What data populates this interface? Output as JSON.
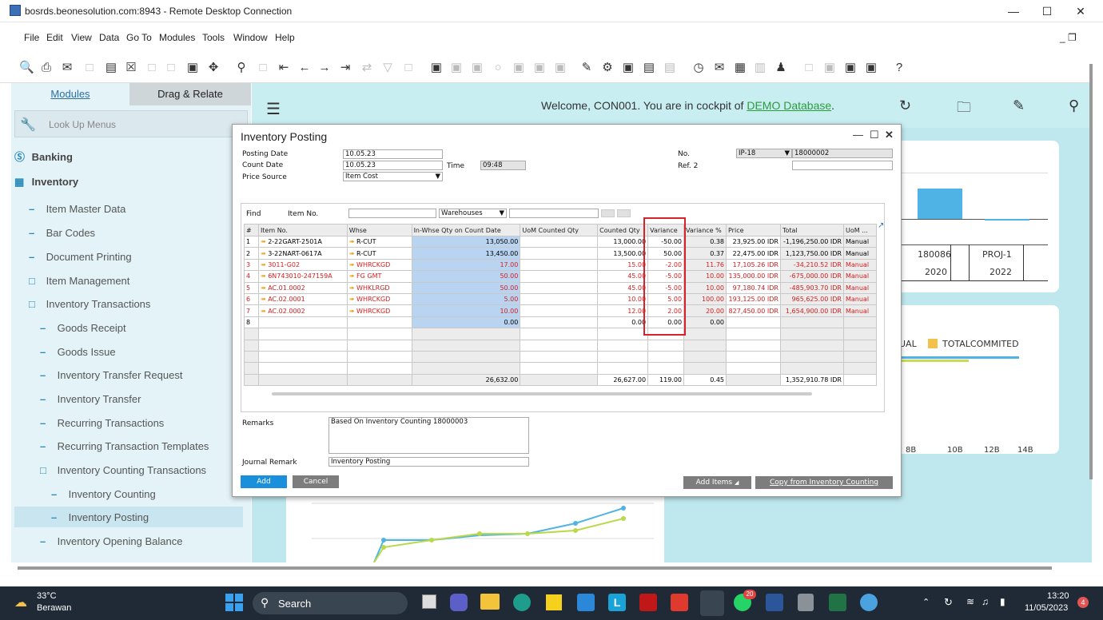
{
  "window_title": "bosrds.beonesolution.com:8943 - Remote Desktop Connection",
  "menu": [
    "File",
    "Edit",
    "View",
    "Data",
    "Go To",
    "Modules",
    "Tools",
    "Window",
    "Help"
  ],
  "left_tabs": {
    "modules": "Modules",
    "drag": "Drag & Relate"
  },
  "lookup_label": "Look Up Menus",
  "nav": {
    "banking": "Banking",
    "inventory": "Inventory",
    "items": [
      "Item Master Data",
      "Bar Codes",
      "Document Printing",
      "Item Management",
      "Inventory Transactions",
      "Goods Receipt",
      "Goods Issue",
      "Inventory Transfer Request",
      "Inventory Transfer",
      "Recurring Transactions",
      "Recurring Transaction Templates",
      "Inventory Counting Transactions",
      "Inventory Counting",
      "Inventory Posting",
      "Inventory Opening Balance"
    ]
  },
  "welcome": {
    "prefix": "Welcome, CON001. You are in cockpit of ",
    "db": "DEMO Database",
    "suffix": "."
  },
  "cockpit": {
    "cols": [
      "180086",
      "PROJ-1"
    ],
    "years": [
      "2020",
      "2022"
    ],
    "legend": [
      "UAL",
      "TOTALCOMMITED"
    ],
    "axis": [
      "8B",
      "10B",
      "12B",
      "14B"
    ]
  },
  "form": {
    "title": "Inventory Posting",
    "posting_date_label": "Posting Date",
    "posting_date": "10.05.23",
    "count_date_label": "Count Date",
    "count_date": "10.05.23",
    "time_label": "Time",
    "time": "09:48",
    "price_source_label": "Price Source",
    "price_source": "Item Cost",
    "no_label": "No.",
    "series": "IP-18",
    "number": "18000002",
    "ref2_label": "Ref. 2",
    "find_label": "Find",
    "item_no_label": "Item No.",
    "warehouses": "Warehouses",
    "columns": [
      "#",
      "Item No.",
      "Whse",
      "In-Whse Qty on Count Date",
      "UoM Counted Qty",
      "Counted Qty",
      "Variance",
      "Variance %",
      "Price",
      "Total",
      "UoM ..."
    ],
    "rows": [
      {
        "n": "1",
        "item": "2-22GART-2501A",
        "whse": "R-CUT",
        "inwhse": "13,050.00",
        "counted": "13,000.00",
        "var": "-50.00",
        "varp": "0.38",
        "price": "23,925.00 IDR",
        "total": "-1,196,250.00 IDR",
        "uom": "Manual",
        "red": false
      },
      {
        "n": "2",
        "item": "3-22NART-0617A",
        "whse": "R-CUT",
        "inwhse": "13,450.00",
        "counted": "13,500.00",
        "var": "50.00",
        "varp": "0.37",
        "price": "22,475.00 IDR",
        "total": "1,123,750.00 IDR",
        "uom": "Manual",
        "red": false
      },
      {
        "n": "3",
        "item": "3011-G02",
        "whse": "WHRCKGD",
        "inwhse": "17.00",
        "counted": "15.00",
        "var": "-2.00",
        "varp": "11.76",
        "price": "17,105.26 IDR",
        "total": "-34,210.52 IDR",
        "uom": "Manual",
        "red": true
      },
      {
        "n": "4",
        "item": "6N743010-247159A",
        "whse": "FG GMT",
        "inwhse": "50.00",
        "counted": "45.00",
        "var": "-5.00",
        "varp": "10.00",
        "price": "135,000.00 IDR",
        "total": "-675,000.00 IDR",
        "uom": "Manual",
        "red": true
      },
      {
        "n": "5",
        "item": "AC.01.0002",
        "whse": "WHKLRGD",
        "inwhse": "50.00",
        "counted": "45.00",
        "var": "-5.00",
        "varp": "10.00",
        "price": "97,180.74 IDR",
        "total": "-485,903.70 IDR",
        "uom": "Manual",
        "red": true
      },
      {
        "n": "6",
        "item": "AC.02.0001",
        "whse": "WHRCKGD",
        "inwhse": "5.00",
        "counted": "10.00",
        "var": "5.00",
        "varp": "100.00",
        "price": "193,125.00 IDR",
        "total": "965,625.00 IDR",
        "uom": "Manual",
        "red": true
      },
      {
        "n": "7",
        "item": "AC.02.0002",
        "whse": "WHRCKGD",
        "inwhse": "10.00",
        "counted": "12.00",
        "var": "2.00",
        "varp": "20.00",
        "price": "827,450.00 IDR",
        "total": "1,654,900.00 IDR",
        "uom": "Manual",
        "red": true
      },
      {
        "n": "8",
        "item": "",
        "whse": "",
        "inwhse": "0.00",
        "counted": "0.00",
        "var": "0.00",
        "varp": "0.00",
        "price": "",
        "total": "",
        "uom": "",
        "red": false
      }
    ],
    "totals": {
      "inwhse": "26,632.00",
      "counted": "26,627.00",
      "var": "119.00",
      "varp": "0.45",
      "total": "1,352,910.78 IDR"
    },
    "remarks_label": "Remarks",
    "remarks": "Based On Inventory Counting 18000003",
    "journal_label": "Journal Remark",
    "journal": "Inventory Posting",
    "add": "Add",
    "cancel": "Cancel",
    "add_items": "Add Items",
    "copy_from": "Copy from Inventory Counting"
  },
  "taskbar": {
    "temp": "33°C",
    "weather": "Berawan",
    "search": "Search",
    "time": "13:20",
    "date": "11/05/2023",
    "badge": "20",
    "notif": "4"
  }
}
